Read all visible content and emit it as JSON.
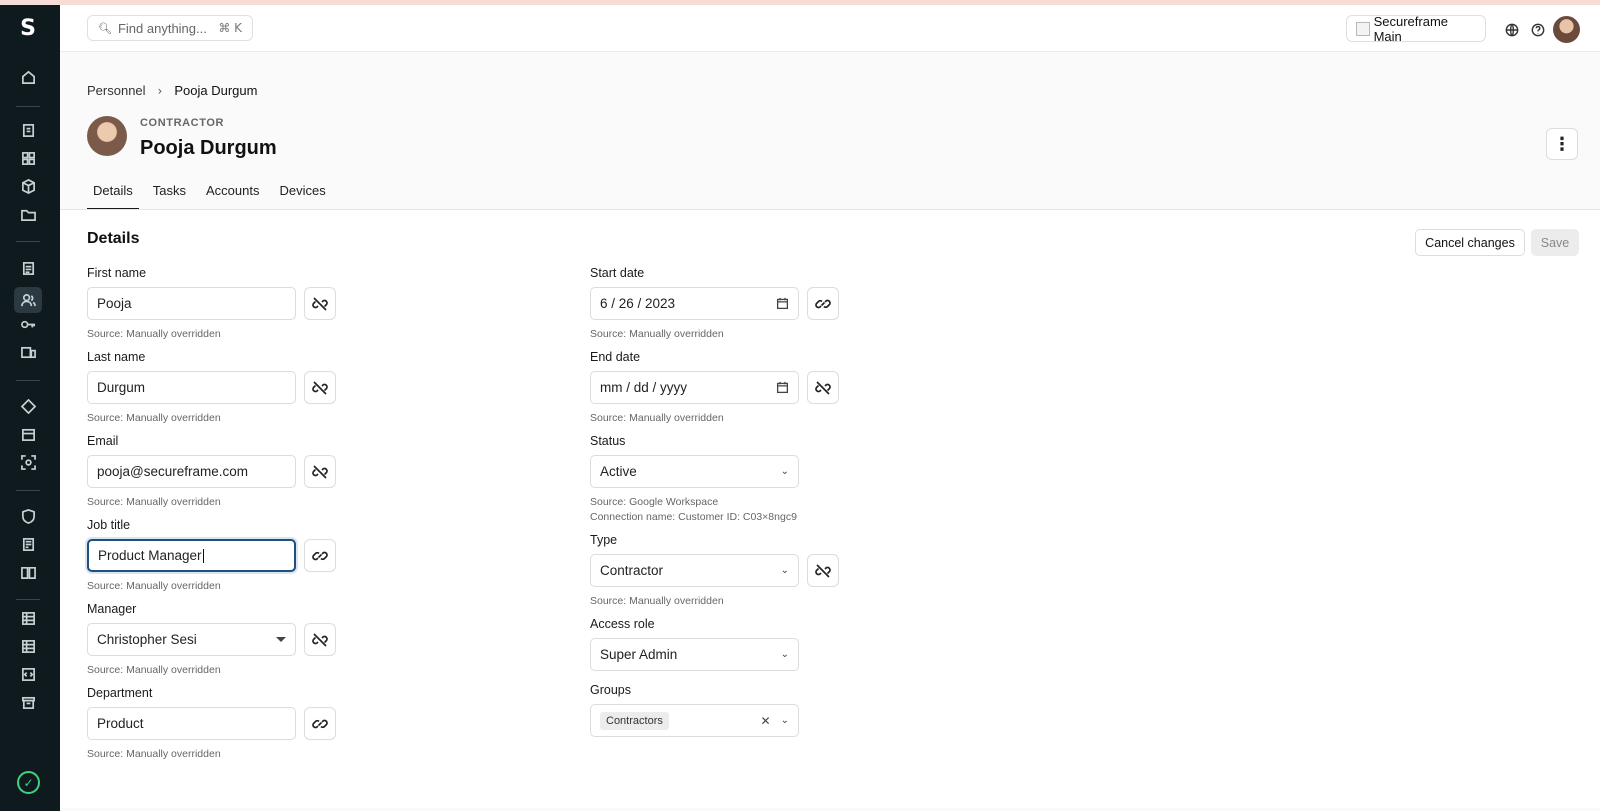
{
  "search": {
    "placeholder": "Find anything...",
    "shortcut": "⌘ K"
  },
  "org": {
    "name": "Secureframe Main"
  },
  "breadcrumb": {
    "parent": "Personnel",
    "current": "Pooja Durgum"
  },
  "person": {
    "role": "CONTRACTOR",
    "name": "Pooja Durgum"
  },
  "tabs": [
    "Details",
    "Tasks",
    "Accounts",
    "Devices"
  ],
  "section": {
    "title": "Details"
  },
  "actions": {
    "cancel": "Cancel changes",
    "save": "Save"
  },
  "left_fields": {
    "first_name": {
      "label": "First name",
      "value": "Pooja",
      "source": "Source: Manually overridden"
    },
    "last_name": {
      "label": "Last name",
      "value": "Durgum",
      "source": "Source: Manually overridden"
    },
    "email": {
      "label": "Email",
      "value": "pooja@secureframe.com",
      "source": "Source: Manually overridden"
    },
    "job_title": {
      "label": "Job title",
      "value": "Product Manager",
      "source": "Source: Manually overridden"
    },
    "manager": {
      "label": "Manager",
      "value": "Christopher Sesi",
      "source": "Source: Manually overridden"
    },
    "department": {
      "label": "Department",
      "value": "Product",
      "source": "Source: Manually overridden"
    }
  },
  "right_fields": {
    "start_date": {
      "label": "Start date",
      "value": "6 / 26 / 2023",
      "source": "Source: Manually overridden"
    },
    "end_date": {
      "label": "End date",
      "value": "mm / dd / yyyy",
      "source": "Source: Manually overridden"
    },
    "status": {
      "label": "Status",
      "value": "Active",
      "source": "Source: Google Workspace",
      "connection": "Connection name: Customer ID: C03×8ngc9"
    },
    "type": {
      "label": "Type",
      "value": "Contractor",
      "source": "Source: Manually overridden"
    },
    "access_role": {
      "label": "Access role",
      "value": "Super Admin"
    },
    "groups": {
      "label": "Groups",
      "tag": "Contractors"
    }
  },
  "colors": {
    "sidebar": "#0f1a1f",
    "focus": "#1f4f7a",
    "status_ok": "#3fd27f"
  }
}
